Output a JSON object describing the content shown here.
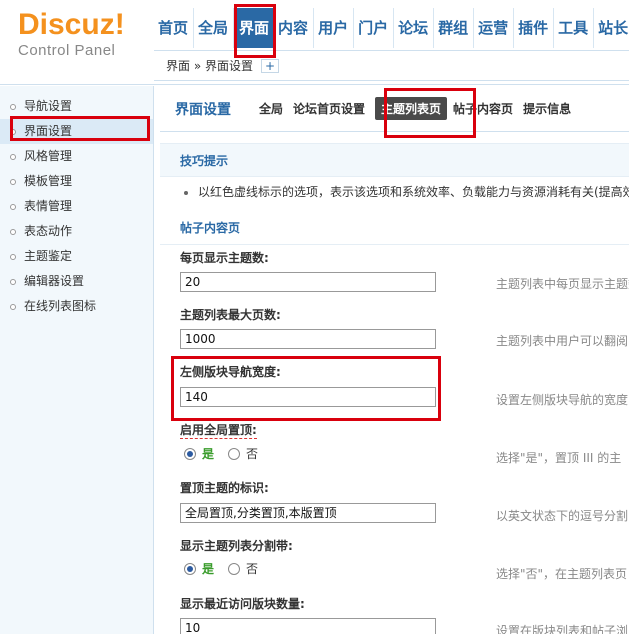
{
  "logo": {
    "brand": "Discuz",
    "bang": "!",
    "subtitle": "Control Panel"
  },
  "topnav": [
    "首页",
    "全局",
    "界面",
    "内容",
    "用户",
    "门户",
    "论坛",
    "群组",
    "运营",
    "插件",
    "工具",
    "站长"
  ],
  "topnav_active": "界面",
  "breadcrumb": {
    "text": "界面 » 界面设置",
    "add": "+"
  },
  "sidebar": {
    "items": [
      "导航设置",
      "界面设置",
      "风格管理",
      "模板管理",
      "表情管理",
      "表态动作",
      "主题鉴定",
      "编辑器设置",
      "在线列表图标"
    ],
    "active": "界面设置"
  },
  "subnav": {
    "title": "界面设置",
    "tabs": [
      "全局",
      "论坛首页设置",
      "主题列表页",
      "帖子内容页",
      "提示信息"
    ],
    "active": "主题列表页"
  },
  "tips": {
    "head": "技巧提示",
    "text": "以红色虚线标示的选项，表示该选项和系统效率、负载能力与资源消耗有关(提高效"
  },
  "section": {
    "title": "帖子内容页"
  },
  "settings": [
    {
      "label": "每页显示主题数:",
      "value": "20",
      "hint": "主题列表中每页显示主题数"
    },
    {
      "label": "主题列表最大页数:",
      "value": "1000",
      "hint": "主题列表中用户可以翻阅"
    },
    {
      "label": "左侧版块导航宽度:",
      "value": "140",
      "hint": "设置左侧版块导航的宽度"
    },
    {
      "label": "启用全局置顶:",
      "yes": "是",
      "no": "否",
      "hint": "选择\"是\"，置顶 III 的主"
    },
    {
      "label": "置顶主题的标识:",
      "value": "全局置顶,分类置顶,本版置顶",
      "hint": "以英文状态下的逗号分割"
    },
    {
      "label": "显示主题列表分割带:",
      "yes": "是",
      "no": "否",
      "hint": "选择\"否\"，在主题列表页"
    },
    {
      "label": "显示最近访问版块数量:",
      "value": "10",
      "hint": "设置在版块列表和帖子浏"
    }
  ],
  "colors": {
    "accent": "#2a69a5",
    "logo": "#f4911e",
    "highlight": "#d9000d",
    "yes": "#3a9c2c"
  }
}
